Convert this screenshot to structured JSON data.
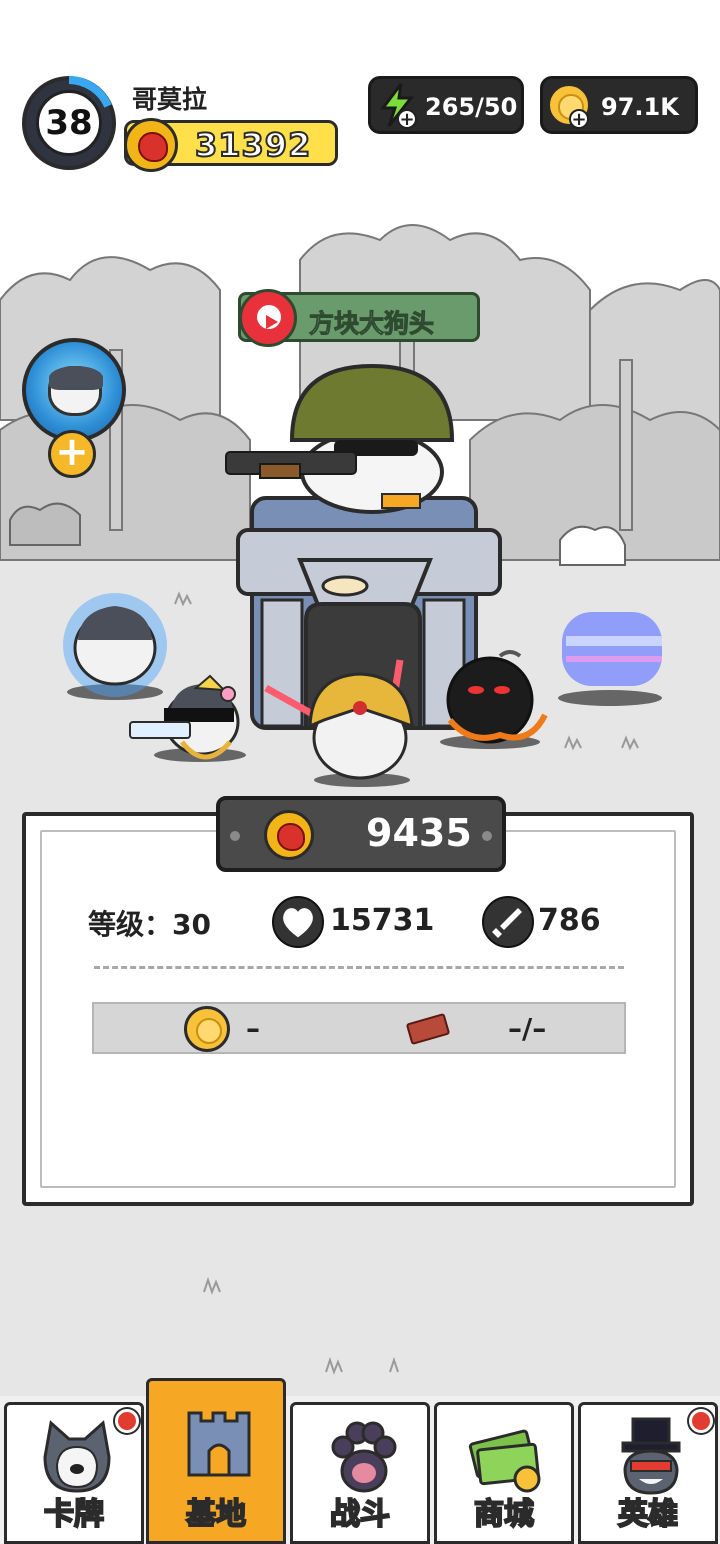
{
  "player": {
    "level": "38",
    "name": "哥莫拉",
    "power": "31392"
  },
  "resources": {
    "energy": "265/50",
    "coins": "97.1K"
  },
  "base": {
    "owner_name": "方块大狗头"
  },
  "stats_panel": {
    "power": "9435",
    "level_label": "等级：30",
    "health": "15731",
    "attack": "786",
    "coin_cost": "–",
    "brick_cost": "–/–"
  },
  "nav": {
    "tabs": [
      {
        "label": "卡牌",
        "icon": "husky-card-icon",
        "badge": true
      },
      {
        "label": "基地",
        "icon": "castle-icon",
        "badge": false,
        "active": true
      },
      {
        "label": "战斗",
        "icon": "paw-icon",
        "badge": false
      },
      {
        "label": "商城",
        "icon": "money-icon",
        "badge": false
      },
      {
        "label": "英雄",
        "icon": "top-hat-dog-icon",
        "badge": true
      }
    ]
  },
  "colors": {
    "gold": "#f6a824",
    "power_red": "#d9312b",
    "banner_green": "#6a9b6c",
    "badge_red": "#e23b2f"
  }
}
